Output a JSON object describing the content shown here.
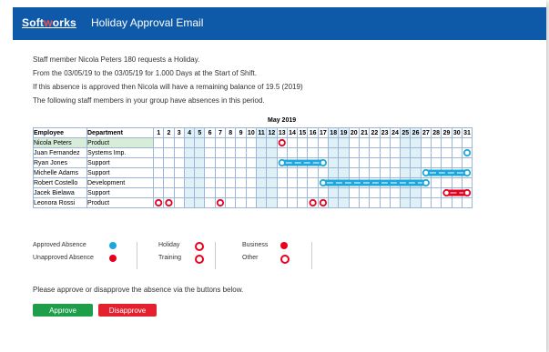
{
  "brand": {
    "name_part1": "Soft",
    "name_mark": "w",
    "name_part2": "orks"
  },
  "header": {
    "title": "Holiday Approval Email"
  },
  "message": {
    "line1": "Staff member Nicola Peters 180 requests a Holiday.",
    "line2": "From the 03/05/19 to the 03/05/19 for 1.000 Days at the Start of Shift.",
    "line3": "If this absence is approved then Nicola will have a remaining balance of 19.5 (2019)",
    "line4": "The following staff members in your group have absences in this period."
  },
  "calendar": {
    "month": "May 2019",
    "col_employee": "Employee",
    "col_department": "Department",
    "days": [
      "1",
      "2",
      "3",
      "4",
      "5",
      "6",
      "7",
      "8",
      "9",
      "10",
      "11",
      "12",
      "13",
      "14",
      "15",
      "16",
      "17",
      "18",
      "19",
      "20",
      "21",
      "22",
      "23",
      "24",
      "25",
      "26",
      "27",
      "28",
      "29",
      "30",
      "31"
    ],
    "weekend_days": [
      4,
      5,
      11,
      12,
      18,
      19,
      25,
      26
    ],
    "rows": [
      {
        "employee": "Nicola Peters",
        "department": "Product",
        "highlight": true
      },
      {
        "employee": "Juan Fernandez",
        "department": "Systems Imp."
      },
      {
        "employee": "Ryan Jones",
        "department": "Support"
      },
      {
        "employee": "Michelle Adams",
        "department": "Support"
      },
      {
        "employee": "Robert Costello",
        "department": "Development"
      },
      {
        "employee": "Jacek Bielawa",
        "department": "Support"
      },
      {
        "employee": "Leonora Rossi",
        "department": "Product"
      }
    ],
    "absences": [
      {
        "row": 0,
        "start": 13,
        "end": 13,
        "kind": "holiday",
        "status": "unapproved"
      },
      {
        "row": 1,
        "start": 31,
        "end": 31,
        "kind": "holiday",
        "status": "approved"
      },
      {
        "row": 2,
        "start": 13,
        "end": 17,
        "kind": "holiday",
        "status": "approved"
      },
      {
        "row": 3,
        "start": 27,
        "end": 31,
        "kind": "holiday",
        "status": "approved"
      },
      {
        "row": 4,
        "start": 17,
        "end": 27,
        "kind": "holiday",
        "status": "approved"
      },
      {
        "row": 5,
        "start": 29,
        "end": 31,
        "kind": "holiday",
        "status": "unapproved"
      },
      {
        "row": 6,
        "start": 1,
        "end": 1,
        "kind": "holiday",
        "status": "unapproved"
      },
      {
        "row": 6,
        "start": 2,
        "end": 2,
        "kind": "holiday",
        "status": "unapproved"
      },
      {
        "row": 6,
        "start": 7,
        "end": 7,
        "kind": "holiday",
        "status": "unapproved"
      },
      {
        "row": 6,
        "start": 16,
        "end": 16,
        "kind": "holiday",
        "status": "unapproved"
      },
      {
        "row": 6,
        "start": 17,
        "end": 17,
        "kind": "holiday",
        "status": "unapproved"
      }
    ],
    "colors": {
      "approved": "#1aa7e0",
      "unapproved": "#e8001c",
      "weekend": "#dff0f7",
      "highlight": "#d7ecd9",
      "header_bar": "#0f5aa8"
    }
  },
  "legend": {
    "approved": "Approved Absence",
    "unapproved": "Unapproved Absence",
    "holiday": "Holiday",
    "training": "Training",
    "business": "Business",
    "other": "Other"
  },
  "footer": {
    "instruction": "Please approve or disapprove the absence via the buttons below."
  },
  "buttons": {
    "approve": "Approve",
    "disapprove": "Disapprove"
  }
}
